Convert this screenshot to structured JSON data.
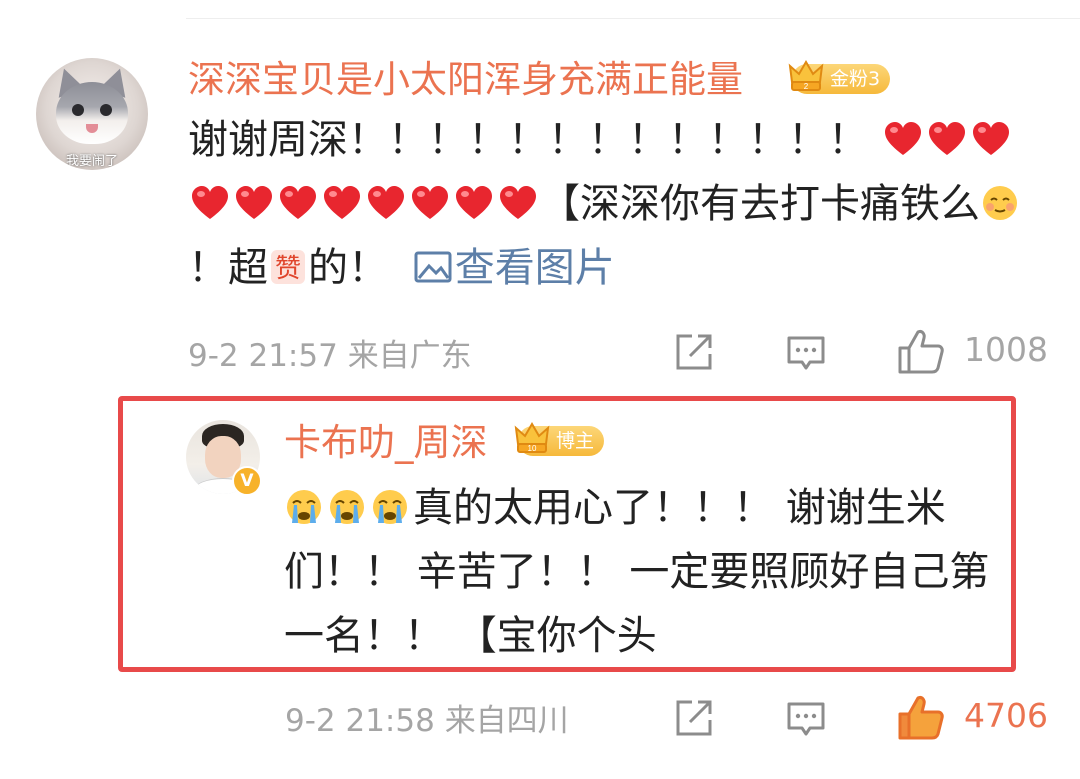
{
  "comment": {
    "avatar_caption": "我要闹了",
    "username": "深深宝贝是小太阳浑身充满正能量",
    "badge": {
      "level_mark": "2",
      "label": "金粉3"
    },
    "text_start": "谢谢周深！！！！！！！！！！！！！",
    "text_mid": "【深深你有去打卡痛铁么",
    "text_mid2": "！超",
    "text_end": "的！",
    "zan_glyph": "赞",
    "view_image_label": "查看图片",
    "timestamp": "9-2 21:57",
    "location": "来自广东",
    "like_count": "1008",
    "hearts": 11
  },
  "reply": {
    "username": "卡布叻_周深",
    "badge": {
      "level_mark": "10",
      "label": "博主"
    },
    "verified_mark": "V",
    "text": "真的太用心了！！！ 谢谢生米们！！ 辛苦了！！ 一定要照顾好自己第一名！！ 【宝你个头",
    "timestamp": "9-2 21:58",
    "location": "来自四川",
    "like_count": "4706",
    "cry_emojis": 3
  },
  "colors": {
    "username": "#eb7350",
    "meta": "#a5a5a5",
    "link": "#5d7fa8",
    "highlight_border": "#e84a4a",
    "liked": "#eb7350"
  }
}
